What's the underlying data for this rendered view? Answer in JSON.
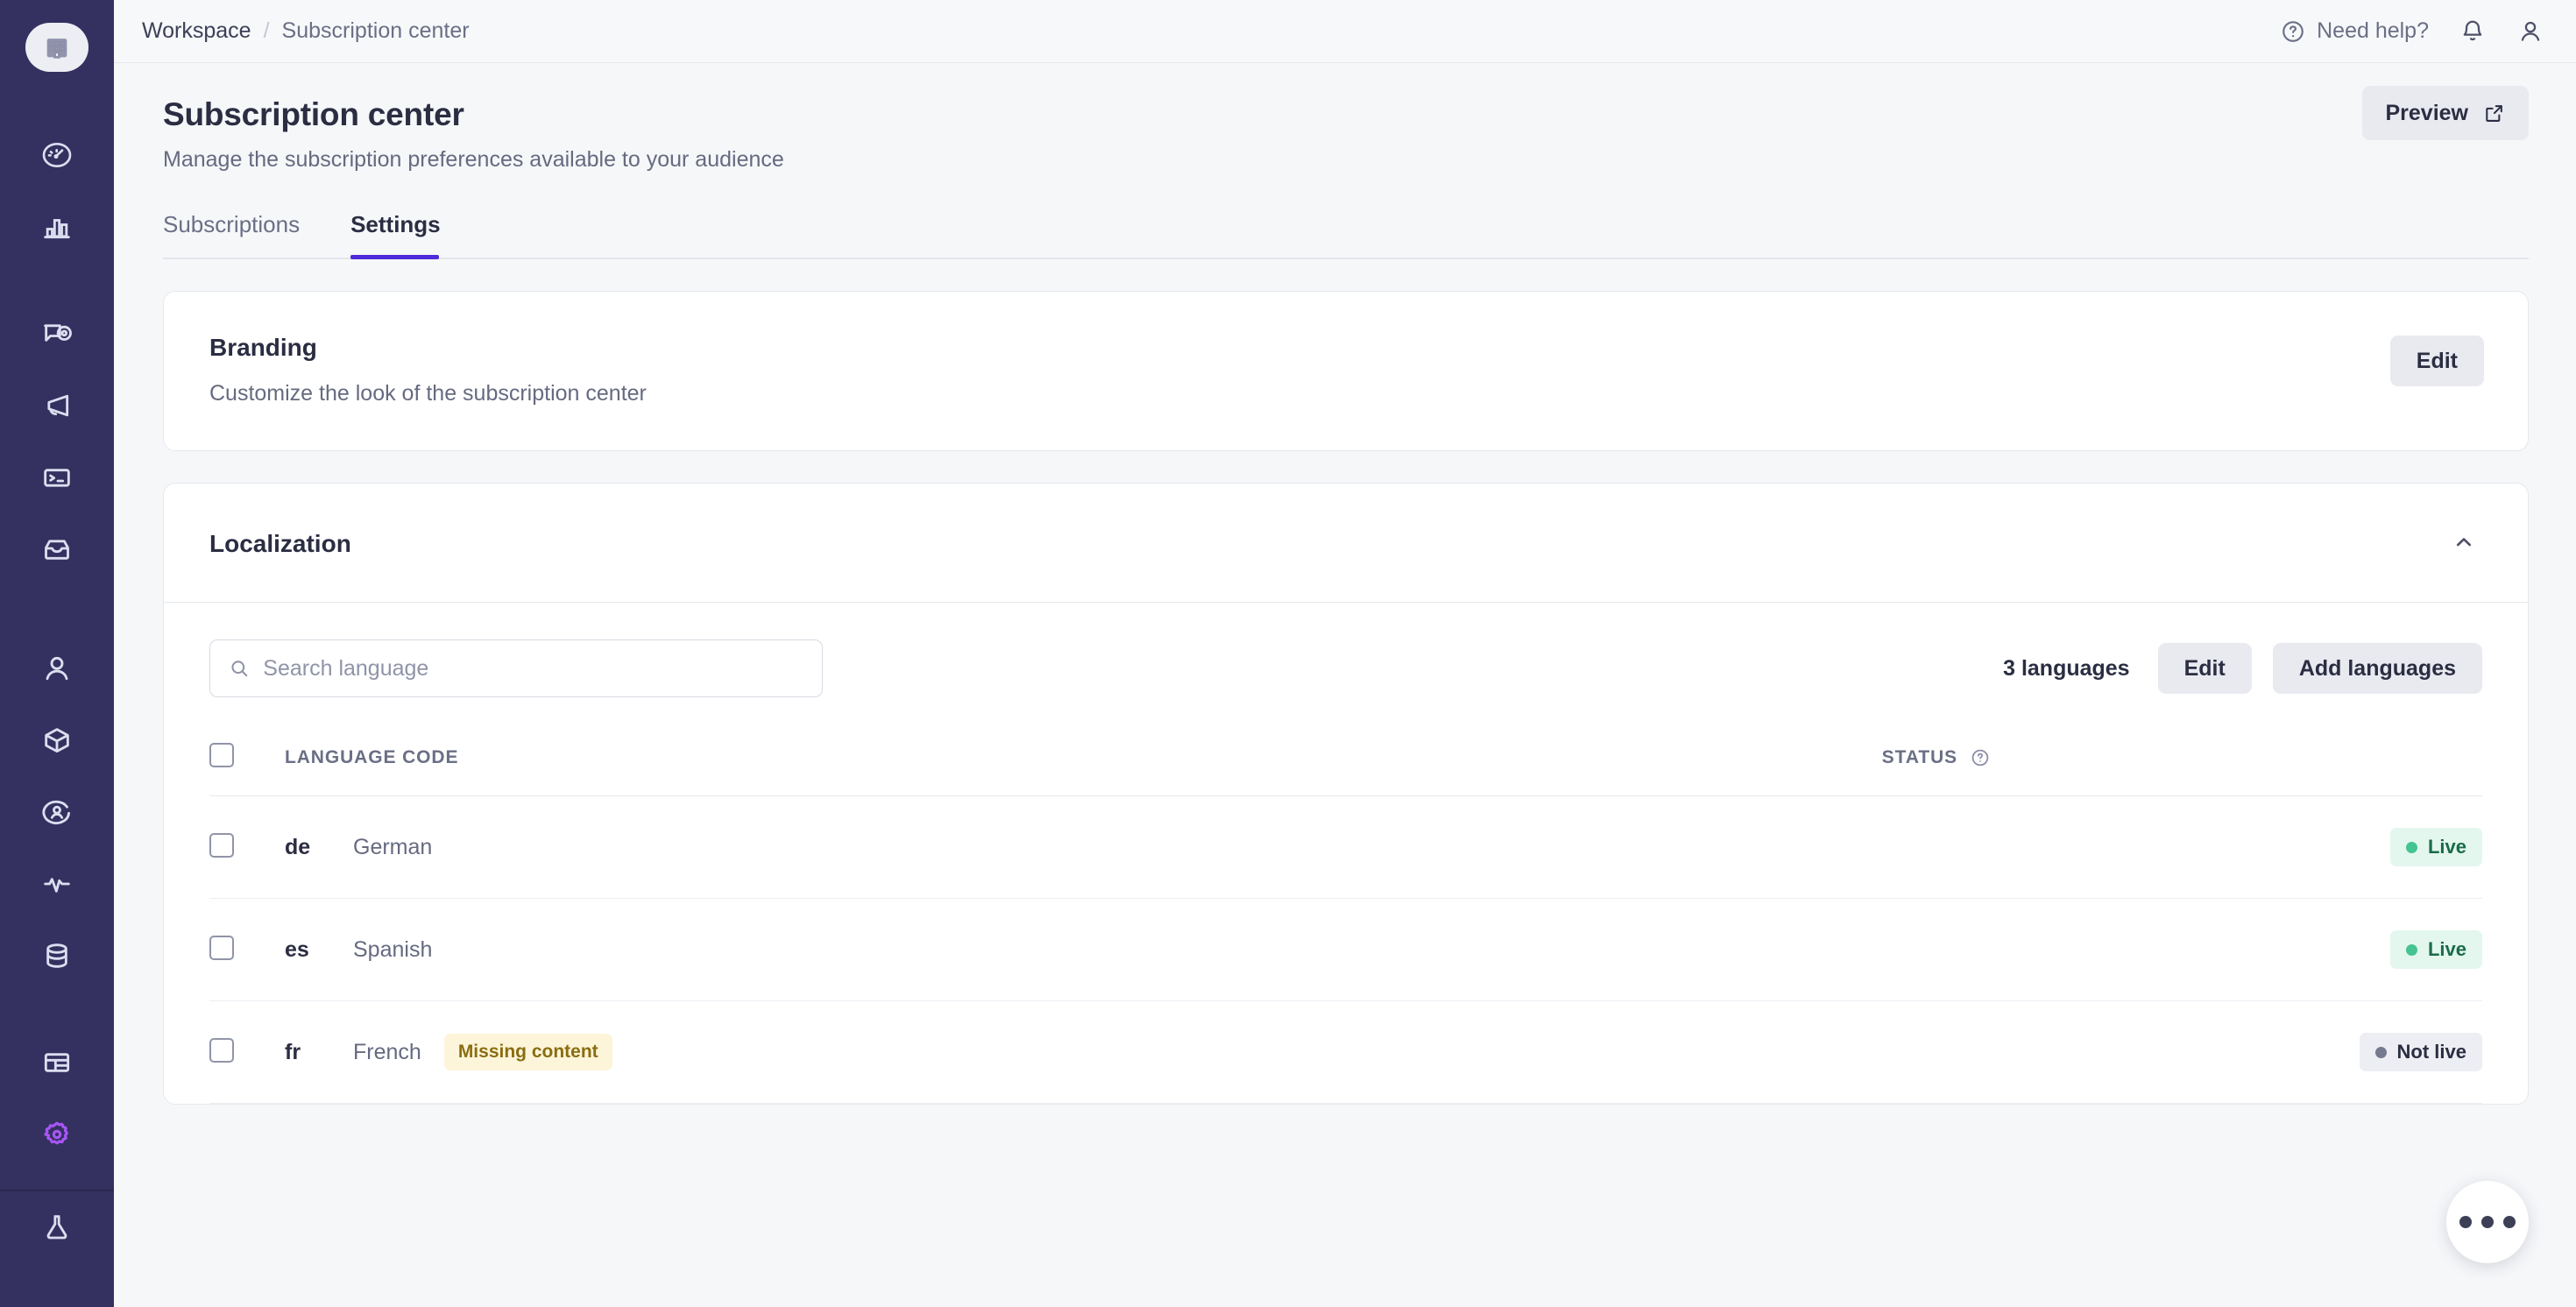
{
  "sidebar": {
    "logo": "building-icon",
    "items": [
      {
        "name": "dashboard-gauge-icon",
        "icon": "gauge-icon",
        "active": false
      },
      {
        "name": "analytics-icon",
        "icon": "bar-chart-icon",
        "active": false
      },
      {
        "name": "message-preview-icon",
        "icon": "chat-eye-icon",
        "active": false
      },
      {
        "name": "campaigns-icon",
        "icon": "megaphone-icon",
        "active": false
      },
      {
        "name": "developer-console-icon",
        "icon": "terminal-icon",
        "active": false
      },
      {
        "name": "inbox-icon",
        "icon": "inbox-icon",
        "active": false
      },
      {
        "name": "users-icon",
        "icon": "person-icon",
        "active": false
      },
      {
        "name": "objects-icon",
        "icon": "cube-icon",
        "active": false
      },
      {
        "name": "audience-icon",
        "icon": "user-circle-icon",
        "active": false
      },
      {
        "name": "activity-icon",
        "icon": "pulse-icon",
        "active": false
      },
      {
        "name": "data-icon",
        "icon": "database-icon",
        "active": false
      },
      {
        "name": "content-icon",
        "icon": "table-icon",
        "active": false
      },
      {
        "name": "settings-icon",
        "icon": "gear-icon",
        "active": true
      },
      {
        "name": "labs-icon",
        "icon": "flask-icon",
        "active": false
      }
    ]
  },
  "topbar": {
    "breadcrumb": {
      "root": "Workspace",
      "separator": "/",
      "current": "Subscription center"
    },
    "need_help": "Need help?",
    "help_icon": "question-circle-icon",
    "bell_icon": "bell-icon",
    "account_icon": "person-icon"
  },
  "page": {
    "title": "Subscription center",
    "subtitle": "Manage the subscription preferences available to your audience",
    "preview_button": "Preview",
    "preview_icon": "external-link-icon"
  },
  "tabs": [
    {
      "label": "Subscriptions",
      "active": false
    },
    {
      "label": "Settings",
      "active": true
    }
  ],
  "branding": {
    "title": "Branding",
    "description": "Customize the look of the subscription center",
    "edit_label": "Edit"
  },
  "localization": {
    "title": "Localization",
    "collapse_icon": "chevron-up-icon",
    "search_placeholder": "Search language",
    "search_value": "",
    "search_icon": "search-icon",
    "count_label": "3 languages",
    "edit_label": "Edit",
    "add_label": "Add languages",
    "columns": {
      "code": "LANGUAGE CODE",
      "status": "STATUS",
      "status_help_icon": "question-circle-icon"
    },
    "rows": [
      {
        "code": "de",
        "name": "German",
        "tag": "",
        "status": "Live",
        "status_type": "live"
      },
      {
        "code": "es",
        "name": "Spanish",
        "tag": "",
        "status": "Live",
        "status_type": "live"
      },
      {
        "code": "fr",
        "name": "French",
        "tag": "Missing content",
        "status": "Not live",
        "status_type": "notlive"
      }
    ]
  },
  "fab": {
    "icon": "more-horizontal-icon"
  },
  "colors": {
    "sidebar_bg": "#343160",
    "accent": "#4f2bd9",
    "page_bg": "#f6f7f9",
    "live_green": "#45c391",
    "warn_amber": "#fdf5d9"
  }
}
